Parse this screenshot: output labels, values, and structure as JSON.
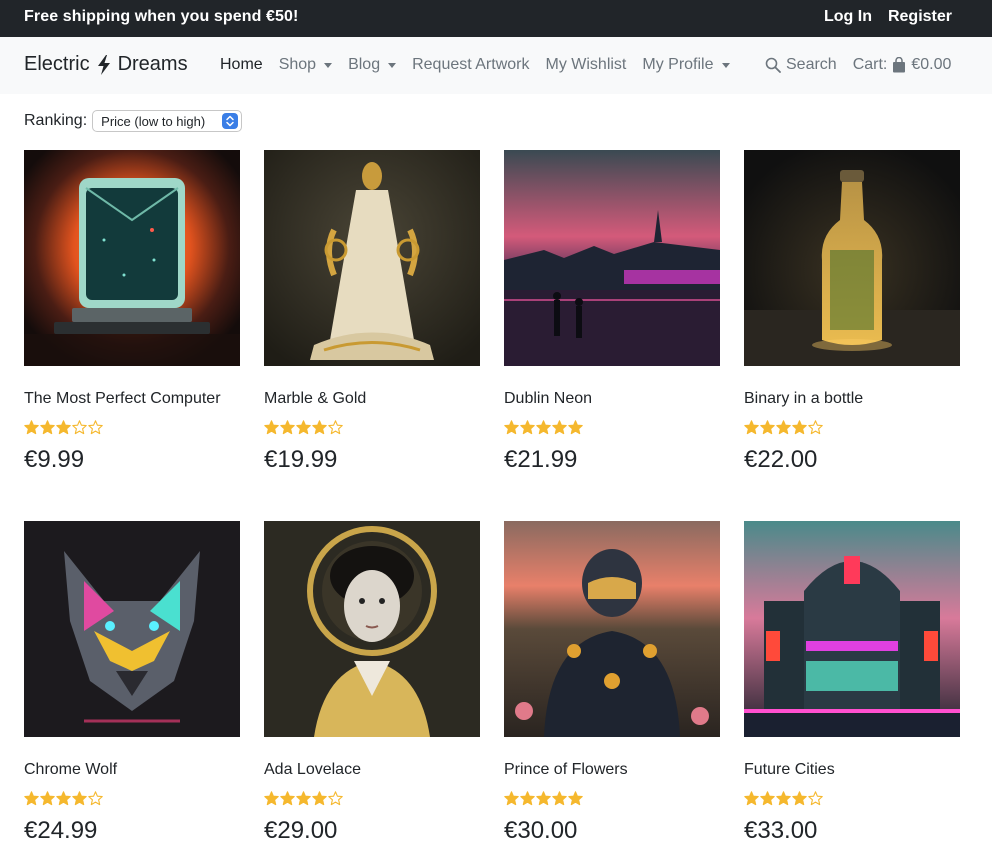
{
  "topbar": {
    "promo": "Free shipping when you spend €50!",
    "login": "Log In",
    "register": "Register"
  },
  "navbar": {
    "brand_part1": "Electric",
    "brand_icon": "lightning-bolt-icon",
    "brand_part2": "Dreams",
    "home": "Home",
    "shop": "Shop",
    "blog": "Blog",
    "request_artwork": "Request Artwork",
    "wishlist": "My Wishlist",
    "profile": "My Profile",
    "search": "Search",
    "cart_label": "Cart:",
    "cart_total": "€0.00"
  },
  "ranking": {
    "label": "Ranking:",
    "selected": "Price (low to high)"
  },
  "products": [
    {
      "name": "The Most Perfect Computer",
      "rating": 3,
      "price": "€9.99"
    },
    {
      "name": "Marble & Gold",
      "rating": 4,
      "price": "€19.99"
    },
    {
      "name": "Dublin Neon",
      "rating": 5,
      "price": "€21.99"
    },
    {
      "name": "Binary in a bottle",
      "rating": 4,
      "price": "€22.00"
    },
    {
      "name": "Chrome Wolf",
      "rating": 4,
      "price": "€24.99"
    },
    {
      "name": "Ada Lovelace",
      "rating": 4,
      "price": "€29.00"
    },
    {
      "name": "Prince of Flowers",
      "rating": 5,
      "price": "€30.00"
    },
    {
      "name": "Future Cities",
      "rating": 4,
      "price": "€33.00"
    }
  ],
  "colors": {
    "star": "#f5b82e",
    "topbar": "#212529",
    "navbar": "#f8f9fa"
  }
}
